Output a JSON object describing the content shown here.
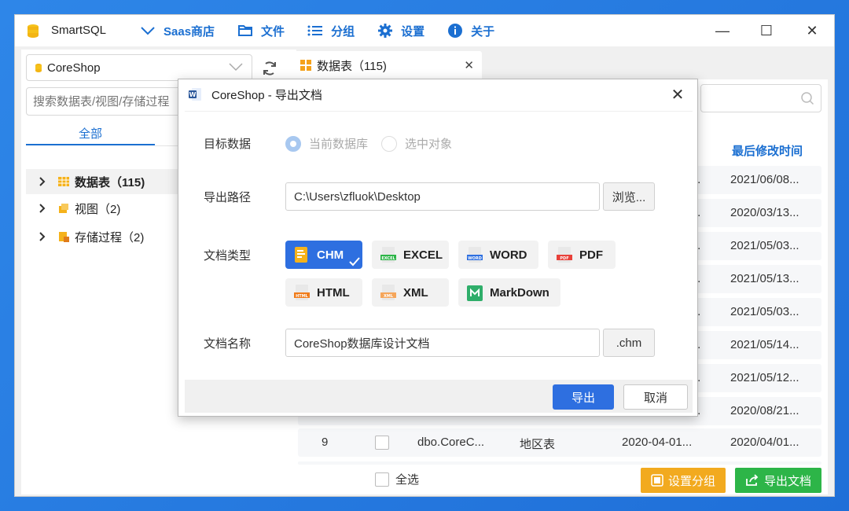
{
  "app": {
    "title": "SmartSQL",
    "menu": [
      {
        "label": "Saas商店",
        "icon": "chevron-down-icon"
      },
      {
        "label": "文件",
        "icon": "folder-icon"
      },
      {
        "label": "分组",
        "icon": "list-icon"
      },
      {
        "label": "设置",
        "icon": "gear-icon"
      },
      {
        "label": "关于",
        "icon": "info-icon"
      }
    ],
    "window_controls": {
      "minimize": "—",
      "maximize": "☐",
      "close": "✕"
    }
  },
  "left": {
    "database": "CoreShop",
    "search_placeholder": "搜索数据表/视图/存储过程",
    "tab": "全部",
    "tree": [
      {
        "label": "数据表（115)",
        "icon": "table-icon"
      },
      {
        "label": "视图（2)",
        "icon": "view-icon"
      },
      {
        "label": "存储过程（2)",
        "icon": "procedure-icon"
      }
    ]
  },
  "right": {
    "tab_label": "数据表（115)",
    "column_header": "最后修改时间",
    "rows_modified": [
      "2021/06/08...",
      "2020/03/13...",
      "2021/05/03...",
      "2021/05/13...",
      "2021/05/03...",
      "2021/05/14...",
      "2021/05/12...",
      "2020/08/21...",
      "2020/04/01..."
    ],
    "row9": {
      "index": "9",
      "name": "dbo.CoreC...",
      "comment": "地区表",
      "created": "2020-04-01..."
    },
    "row_partial_ellipsis": "..",
    "select_all": "全选",
    "btn_set_group": "设置分组",
    "btn_export_doc": "导出文档"
  },
  "dialog": {
    "title": "CoreShop - 导出文档",
    "labels": {
      "target": "目标数据",
      "path": "导出路径",
      "type": "文档类型",
      "name": "文档名称"
    },
    "radio_current": "当前数据库",
    "radio_selected": "选中对象",
    "path_value": "C:\\Users\\zfluok\\Desktop",
    "browse": "浏览...",
    "doc_types": [
      "CHM",
      "EXCEL",
      "WORD",
      "PDF",
      "HTML",
      "XML",
      "MarkDown"
    ],
    "selected_type": "CHM",
    "doc_name_value": "CoreShop数据库设计文档",
    "extension": ".chm",
    "ok": "导出",
    "cancel": "取消"
  },
  "colors": {
    "accent": "#2e6fe0",
    "menu_blue": "#1b6fd1",
    "orange": "#f2aa1f",
    "green": "#2db548"
  }
}
